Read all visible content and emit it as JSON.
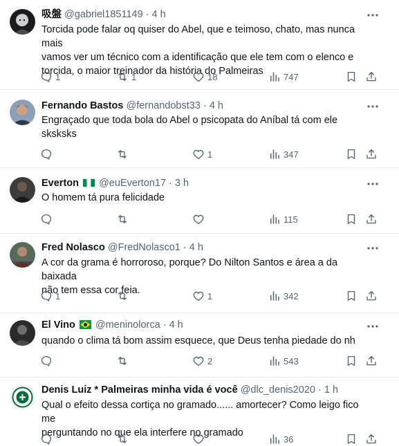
{
  "tweets": [
    {
      "avatar_icon": "avatar-dark-anime-icon",
      "display_name": "吸盤",
      "handle": "@gabriel1851149",
      "separator": "·",
      "time": "4 h",
      "text_lines": [
        "Torcida pode falar oq quiser do Abel, que e teimoso, chato, mas nunca mais",
        "vamos ver um técnico com a identificação que ele tem com o elenco e",
        "torcida, o maior treinador da história do Palmeiras"
      ],
      "replies": "1",
      "retweets": "1",
      "likes": "18",
      "views": "747"
    },
    {
      "avatar_icon": "avatar-photo-icon",
      "display_name": "Fernando Bastos",
      "handle": "@fernandobst33",
      "separator": "·",
      "time": "4 h",
      "text_lines": [
        "Engraçado que toda bola do Abel o psicopata do Aníbal tá com ele",
        "sksksks"
      ],
      "replies": "",
      "retweets": "",
      "likes": "1",
      "views": "347"
    },
    {
      "avatar_icon": "avatar-photo-icon",
      "display_name": "Everton",
      "flag": "nigeria-flag-icon",
      "handle": "@euEverton17",
      "separator": "·",
      "time": "3 h",
      "text_lines": [
        "O homem tá pura felicidade"
      ],
      "replies": "",
      "retweets": "",
      "likes": "",
      "views": "115"
    },
    {
      "avatar_icon": "avatar-photo-icon",
      "display_name": "Fred Nolasco",
      "handle": "@FredNolasco1",
      "separator": "·",
      "time": "4 h",
      "text_lines": [
        "A cor da grama é horroroso, porque? Do Nilton Santos e área a da baixada",
        "não tem essa cor feia."
      ],
      "replies": "1",
      "retweets": "",
      "likes": "1",
      "views": "342"
    },
    {
      "avatar_icon": "avatar-photo-icon",
      "display_name": "El Vino",
      "flag": "brazil-flag-icon",
      "handle": "@meninolorca",
      "separator": "·",
      "time": "4 h",
      "text_lines": [
        "quando o clima tá bom assim esquece, que Deus tenha piedade do nh"
      ],
      "replies": "",
      "retweets": "",
      "likes": "2",
      "views": "543"
    },
    {
      "avatar_icon": "avatar-palmeiras-crest-icon",
      "display_name": "Denis Luiz * Palmeiras minha vida é você",
      "handle": "@dlc_denis2020",
      "separator": "·",
      "time": "1 h",
      "text_lines": [
        "Qual o efeito dessa cortiça no gramado...... amortecer? Como leigo fico me",
        "perguntando no que ela interfere no gramado"
      ],
      "replies": "",
      "retweets": "",
      "likes": "",
      "views": "36"
    }
  ],
  "colors": {
    "text": "#0f1419",
    "secondary": "#536471",
    "divider": "#e6ecf0"
  }
}
